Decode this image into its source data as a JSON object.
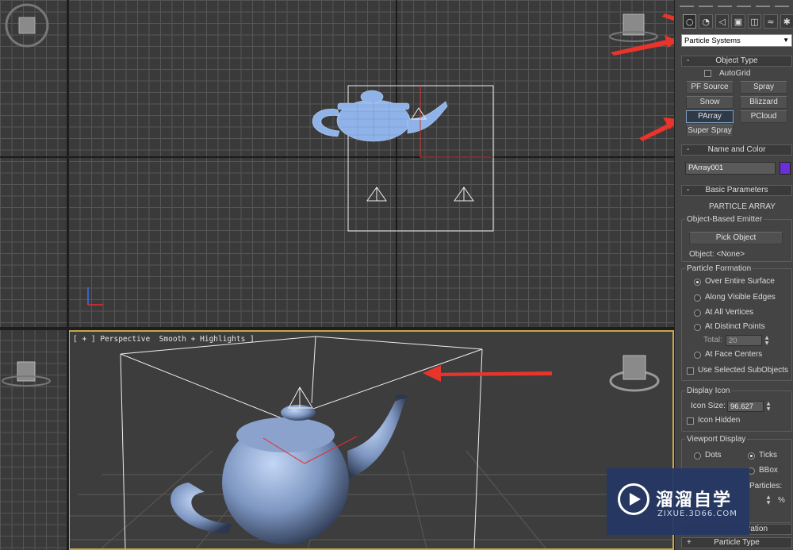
{
  "viewport": {
    "perspective_label": "[ + ] Perspective  Smooth + Highlights ]"
  },
  "panel": {
    "category_dropdown": "Particle Systems",
    "object_type": {
      "header": "Object Type",
      "autogrid": "AutoGrid",
      "buttons": [
        "PF Source",
        "Spray",
        "Snow",
        "Blizzard",
        "PArray",
        "PCloud",
        "Super Spray"
      ],
      "active": "PArray"
    },
    "name_color": {
      "header": "Name and Color",
      "name_value": "PArray001",
      "swatch_color": "#6a2fd6"
    },
    "basic_params": {
      "header": "Basic Parameters",
      "title": "PARTICLE ARRAY",
      "emitter_group": "Object-Based Emitter",
      "pick_button": "Pick Object",
      "object_label": "Object: <None>",
      "formation_group": "Particle Formation",
      "formation_options": [
        "Over Entire Surface",
        "Along Visible Edges",
        "At All Vertices",
        "At Distinct Points",
        "At Face Centers"
      ],
      "formation_selected": "Over Entire Surface",
      "total_label": "Total:",
      "total_value": "20",
      "use_selected": "Use Selected SubObjects",
      "display_icon_group": "Display Icon",
      "icon_size_label": "Icon Size:",
      "icon_size_value": "96.627",
      "icon_hidden": "Icon Hidden",
      "viewport_display_group": "Viewport Display",
      "dots": "Dots",
      "ticks": "Ticks",
      "bbox": "BBox",
      "particles_label": "Particles:",
      "percent_sign": "%",
      "generation_partial": "ration",
      "particle_type": "Particle Type"
    }
  },
  "watermark": {
    "cn_text": "溜溜自学",
    "url": "ZIXUE.3D66.COM"
  },
  "colors": {
    "accent_arrow": "#e8342a",
    "teapot_wire": "#8fb3e8",
    "active_border": "#c8a64a"
  }
}
